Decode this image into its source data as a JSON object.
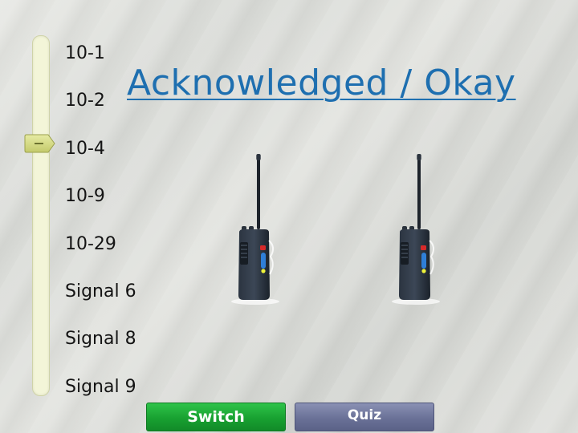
{
  "codes": [
    "10-1",
    "10-2",
    "10-4",
    "10-9",
    "10-29",
    "Signal 6",
    "Signal 8",
    "Signal 9"
  ],
  "selected_code": "10-4",
  "meaning": "Acknowledged / Okay",
  "buttons": {
    "switch_label": "Switch",
    "quiz_label": "Quiz"
  },
  "colors": {
    "meaning_text": "#1e6fb0",
    "switch_button": "#1ea836",
    "quiz_button": "#6a7197",
    "slider_track": "#f3f5d8",
    "slider_handle": "#d6dc8a"
  },
  "icons": {
    "radio": "walkie-talkie-icon",
    "handle": "slider-arrow-handle"
  }
}
